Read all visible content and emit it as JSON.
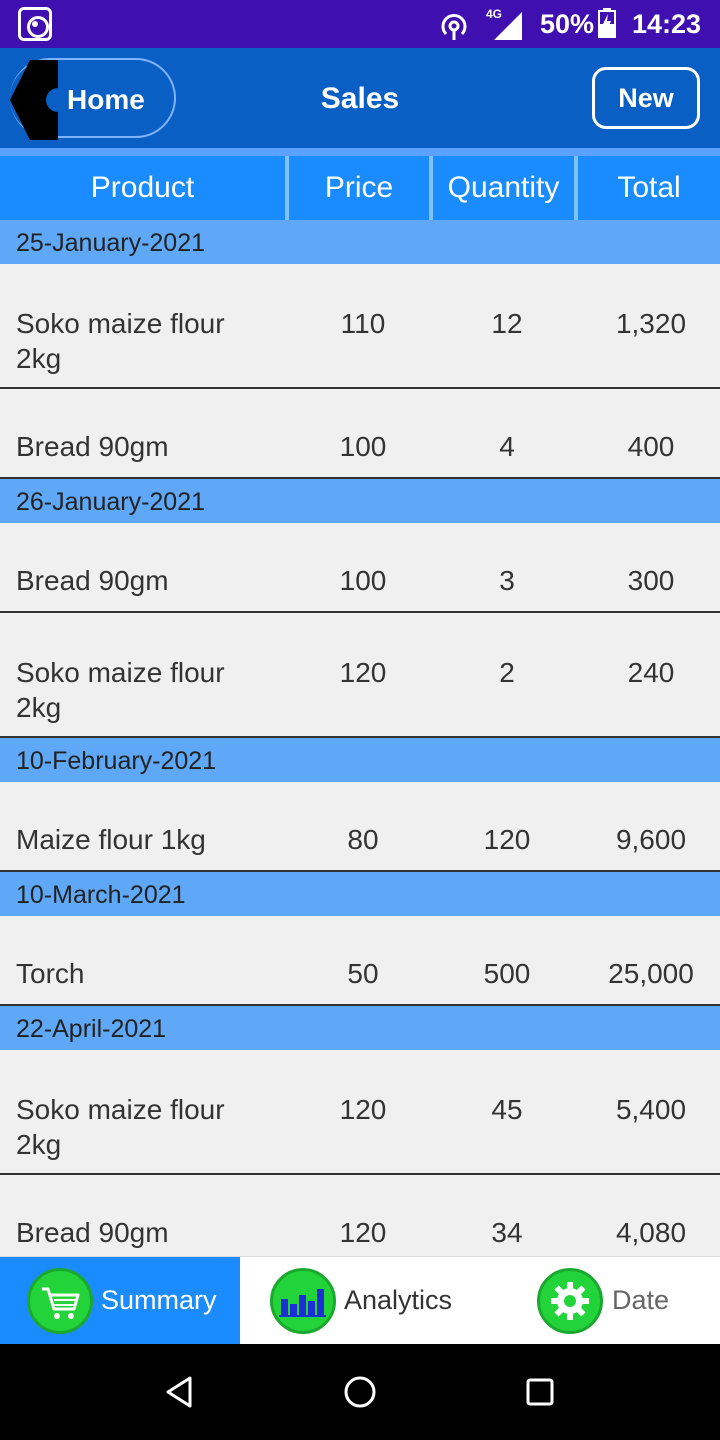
{
  "status_bar": {
    "battery": "50%",
    "time": "14:23",
    "network": "4G",
    "icons": [
      "app-icon",
      "hotspot-icon",
      "signal-icon",
      "battery-icon"
    ]
  },
  "app_bar": {
    "home_label": "Home",
    "title": "Sales",
    "new_label": "New",
    "accent_color": "#0a5fc4"
  },
  "table_header": [
    "Product",
    "Price",
    "Quantity",
    "Total"
  ],
  "groups": [
    {
      "date": "25-January-2021",
      "rows": [
        {
          "product": "Soko maize flour 2kg",
          "price": "110",
          "quantity": "12",
          "total": "1,320"
        },
        {
          "product": "Bread 90gm",
          "price": "100",
          "quantity": "4",
          "total": "400"
        }
      ]
    },
    {
      "date": "26-January-2021",
      "rows": [
        {
          "product": "Bread 90gm",
          "price": "100",
          "quantity": "3",
          "total": "300"
        },
        {
          "product": "Soko maize flour 2kg",
          "price": "120",
          "quantity": "2",
          "total": "240"
        }
      ]
    },
    {
      "date": "10-February-2021",
      "rows": [
        {
          "product": "Maize flour 1kg",
          "price": "80",
          "quantity": "120",
          "total": "9,600"
        }
      ]
    },
    {
      "date": "10-March-2021",
      "rows": [
        {
          "product": "Torch",
          "price": "50",
          "quantity": "500",
          "total": "25,000"
        }
      ]
    },
    {
      "date": "22-April-2021",
      "rows": [
        {
          "product": "Soko maize flour 2kg",
          "price": "120",
          "quantity": "45",
          "total": "5,400"
        },
        {
          "product": "Bread 90gm",
          "price": "120",
          "quantity": "34",
          "total": "4,080"
        }
      ]
    }
  ],
  "tabs": [
    {
      "label": "Summary",
      "icon": "cart-icon",
      "selected": true
    },
    {
      "label": "Analytics",
      "icon": "bar-chart-icon",
      "selected": false
    },
    {
      "label": "Date",
      "icon": "gear-icon",
      "selected": false
    }
  ],
  "nav_bar": {
    "icons": [
      "back-icon",
      "home-icon",
      "recents-icon"
    ]
  }
}
